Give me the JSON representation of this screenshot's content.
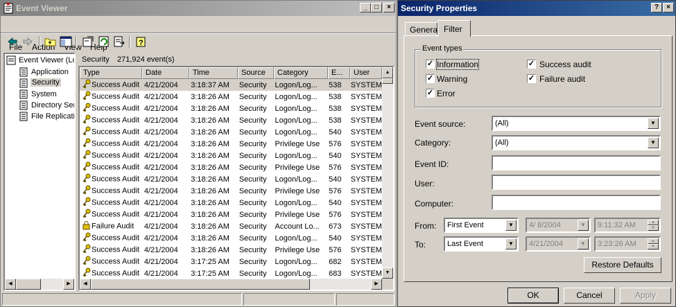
{
  "event_viewer": {
    "title": "Event Viewer",
    "menu": [
      "File",
      "Action",
      "View",
      "Help"
    ],
    "tree": {
      "root": "Event Viewer (Lo",
      "items": [
        "Application",
        "Security",
        "System",
        "Directory Ser",
        "File Replicatio"
      ],
      "selected": "Security"
    },
    "list_header": {
      "log_name": "Security",
      "event_count": "271,924 event(s)"
    },
    "columns": [
      "Type",
      "Date",
      "Time",
      "Source",
      "Category",
      "E...",
      "User"
    ],
    "rows": [
      {
        "type": "Success Audit",
        "date": "4/21/2004",
        "time": "3:18:37 AM",
        "source": "Security",
        "category": "Logon/Log...",
        "event": "538",
        "user": "SYSTEM"
      },
      {
        "type": "Success Audit",
        "date": "4/21/2004",
        "time": "3:18:26 AM",
        "source": "Security",
        "category": "Logon/Log...",
        "event": "538",
        "user": "SYSTEM"
      },
      {
        "type": "Success Audit",
        "date": "4/21/2004",
        "time": "3:18:26 AM",
        "source": "Security",
        "category": "Logon/Log...",
        "event": "538",
        "user": "SYSTEM"
      },
      {
        "type": "Success Audit",
        "date": "4/21/2004",
        "time": "3:18:26 AM",
        "source": "Security",
        "category": "Logon/Log...",
        "event": "538",
        "user": "SYSTEM"
      },
      {
        "type": "Success Audit",
        "date": "4/21/2004",
        "time": "3:18:26 AM",
        "source": "Security",
        "category": "Logon/Log...",
        "event": "540",
        "user": "SYSTEM"
      },
      {
        "type": "Success Audit",
        "date": "4/21/2004",
        "time": "3:18:26 AM",
        "source": "Security",
        "category": "Privilege Use",
        "event": "576",
        "user": "SYSTEM"
      },
      {
        "type": "Success Audit",
        "date": "4/21/2004",
        "time": "3:18:26 AM",
        "source": "Security",
        "category": "Logon/Log...",
        "event": "540",
        "user": "SYSTEM"
      },
      {
        "type": "Success Audit",
        "date": "4/21/2004",
        "time": "3:18:26 AM",
        "source": "Security",
        "category": "Privilege Use",
        "event": "576",
        "user": "SYSTEM"
      },
      {
        "type": "Success Audit",
        "date": "4/21/2004",
        "time": "3:18:26 AM",
        "source": "Security",
        "category": "Logon/Log...",
        "event": "540",
        "user": "SYSTEM"
      },
      {
        "type": "Success Audit",
        "date": "4/21/2004",
        "time": "3:18:26 AM",
        "source": "Security",
        "category": "Privilege Use",
        "event": "576",
        "user": "SYSTEM"
      },
      {
        "type": "Success Audit",
        "date": "4/21/2004",
        "time": "3:18:26 AM",
        "source": "Security",
        "category": "Logon/Log...",
        "event": "540",
        "user": "SYSTEM"
      },
      {
        "type": "Success Audit",
        "date": "4/21/2004",
        "time": "3:18:26 AM",
        "source": "Security",
        "category": "Privilege Use",
        "event": "576",
        "user": "SYSTEM"
      },
      {
        "type": "Failure Audit",
        "date": "4/21/2004",
        "time": "3:18:26 AM",
        "source": "Security",
        "category": "Account Lo...",
        "event": "673",
        "user": "SYSTEM"
      },
      {
        "type": "Success Audit",
        "date": "4/21/2004",
        "time": "3:18:26 AM",
        "source": "Security",
        "category": "Logon/Log...",
        "event": "540",
        "user": "SYSTEM"
      },
      {
        "type": "Success Audit",
        "date": "4/21/2004",
        "time": "3:18:26 AM",
        "source": "Security",
        "category": "Privilege Use",
        "event": "576",
        "user": "SYSTEM"
      },
      {
        "type": "Success Audit",
        "date": "4/21/2004",
        "time": "3:17:25 AM",
        "source": "Security",
        "category": "Logon/Log...",
        "event": "682",
        "user": "SYSTEM"
      },
      {
        "type": "Success Audit",
        "date": "4/21/2004",
        "time": "3:17:25 AM",
        "source": "Security",
        "category": "Logon/Log...",
        "event": "683",
        "user": "SYSTEM"
      }
    ]
  },
  "security_properties": {
    "title": "Security Properties",
    "title_buttons": [
      "?",
      "×"
    ],
    "tabs": [
      "General",
      "Filter"
    ],
    "active_tab": "Filter",
    "event_types": {
      "legend": "Event types",
      "information": {
        "label": "Information",
        "checked": true
      },
      "warning": {
        "label": "Warning",
        "checked": true
      },
      "error": {
        "label": "Error",
        "checked": true
      },
      "success_audit": {
        "label": "Success audit",
        "checked": true
      },
      "failure_audit": {
        "label": "Failure audit",
        "checked": true
      }
    },
    "event_source": {
      "label": "Event source:",
      "value": "(All)"
    },
    "category": {
      "label": "Category:",
      "value": "(All)"
    },
    "event_id": {
      "label": "Event ID:",
      "value": ""
    },
    "user": {
      "label": "User:",
      "value": ""
    },
    "computer": {
      "label": "Computer:",
      "value": ""
    },
    "from": {
      "label": "From:",
      "value": "First Event",
      "date": "4/ 8/2004",
      "time": "9:11:32 AM"
    },
    "to": {
      "label": "To:",
      "value": "Last Event",
      "date": "4/21/2004",
      "time": "3:23:26 AM"
    },
    "restore_defaults": "Restore Defaults",
    "ok": "OK",
    "cancel": "Cancel",
    "apply": "Apply"
  },
  "colors": {
    "face": "#d4d0c8",
    "title_active": "#0a246a",
    "title_inactive": "#808080",
    "selection": "#0a246a",
    "row_selected": "#d4d0c8"
  }
}
